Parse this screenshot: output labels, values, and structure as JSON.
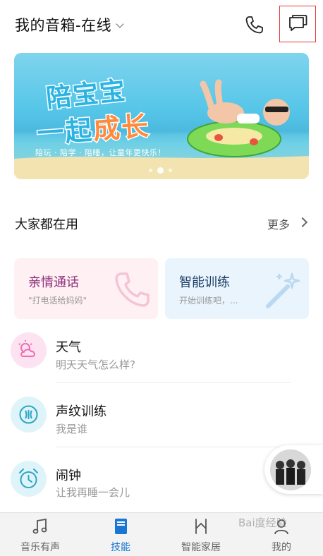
{
  "header": {
    "title": "我的音箱-在线"
  },
  "banner": {
    "line1": "陪宝宝",
    "line2_prefix": "一起",
    "line2_highlight": "成长",
    "subtitle": "陪玩 · 陪学 · 陪睡，让童年更快乐！",
    "page_count": 3,
    "active_page": 2
  },
  "section": {
    "title": "大家都在用",
    "more_label": "更多"
  },
  "cards": [
    {
      "title": "亲情通话",
      "subtitle": "\"打电话给妈妈\""
    },
    {
      "title": "智能训练",
      "subtitle": "开始训练吧，..."
    }
  ],
  "list": [
    {
      "title": "天气",
      "subtitle": "明天天气怎么样?",
      "icon": "weather-icon",
      "color": "#fde3f2"
    },
    {
      "title": "声纹训练",
      "subtitle": "我是谁",
      "icon": "voiceprint-icon",
      "color": "#dff4f8"
    },
    {
      "title": "闹钟",
      "subtitle": "让我再睡一会儿",
      "icon": "alarm-icon",
      "color": "#dff4f8"
    }
  ],
  "nav": [
    {
      "label": "音乐有声",
      "icon": "music-note-icon"
    },
    {
      "label": "技能",
      "icon": "skill-book-icon"
    },
    {
      "label": "智能家居",
      "icon": "smart-home-icon"
    },
    {
      "label": "我的",
      "icon": "profile-icon"
    }
  ],
  "watermark": "Bai度经验",
  "colors": {
    "accent": "#1976d2",
    "highlight_border": "#e53935"
  }
}
